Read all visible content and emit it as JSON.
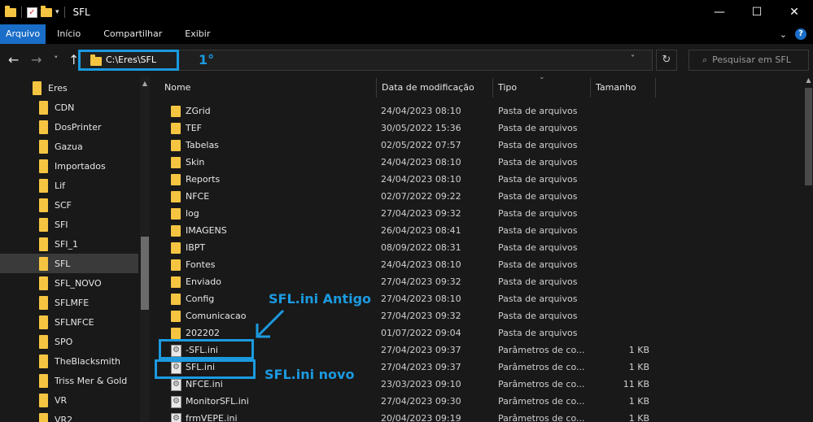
{
  "window": {
    "title": "SFL",
    "controls": {
      "minimize": "—",
      "maximize": "☐",
      "close": "✕"
    }
  },
  "ribbon": {
    "tabs": [
      {
        "label": "Arquivo",
        "active": true
      },
      {
        "label": "Início"
      },
      {
        "label": "Compartilhar"
      },
      {
        "label": "Exibir"
      }
    ],
    "expand_icon": "chevron-down-icon",
    "help": "?"
  },
  "nav": {
    "back": "←",
    "forward": "→",
    "recent": "˅",
    "up": "↑",
    "address": "C:\\Eres\\SFL",
    "address_dropdown": "˅",
    "refresh": "↻",
    "search_placeholder": "Pesquisar em SFL"
  },
  "sidebar": {
    "items": [
      {
        "label": "Eres"
      },
      {
        "label": "CDN"
      },
      {
        "label": "DosPrinter"
      },
      {
        "label": "Gazua"
      },
      {
        "label": "Importados"
      },
      {
        "label": "Lif"
      },
      {
        "label": "SCF"
      },
      {
        "label": "SFI"
      },
      {
        "label": "SFI_1"
      },
      {
        "label": "SFL",
        "selected": true
      },
      {
        "label": "SFL_NOVO"
      },
      {
        "label": "SFLMFE"
      },
      {
        "label": "SFLNFCE"
      },
      {
        "label": "SPO"
      },
      {
        "label": "TheBlacksmith"
      },
      {
        "label": "Triss Mer & Gold"
      },
      {
        "label": "VR"
      },
      {
        "label": "VR2"
      }
    ]
  },
  "columns": {
    "name": "Nome",
    "date": "Data de modificação",
    "type": "Tipo",
    "size": "Tamanho"
  },
  "files": [
    {
      "name": "ZGrid",
      "date": "24/04/2023 08:10",
      "type": "Pasta de arquivos",
      "size": "",
      "kind": "folder"
    },
    {
      "name": "TEF",
      "date": "30/05/2022 15:36",
      "type": "Pasta de arquivos",
      "size": "",
      "kind": "folder"
    },
    {
      "name": "Tabelas",
      "date": "02/05/2022 07:57",
      "type": "Pasta de arquivos",
      "size": "",
      "kind": "folder"
    },
    {
      "name": "Skin",
      "date": "24/04/2023 08:10",
      "type": "Pasta de arquivos",
      "size": "",
      "kind": "folder"
    },
    {
      "name": "Reports",
      "date": "24/04/2023 08:10",
      "type": "Pasta de arquivos",
      "size": "",
      "kind": "folder"
    },
    {
      "name": "NFCE",
      "date": "02/07/2022 09:22",
      "type": "Pasta de arquivos",
      "size": "",
      "kind": "folder"
    },
    {
      "name": "log",
      "date": "27/04/2023 09:32",
      "type": "Pasta de arquivos",
      "size": "",
      "kind": "folder"
    },
    {
      "name": "IMAGENS",
      "date": "26/04/2023 08:41",
      "type": "Pasta de arquivos",
      "size": "",
      "kind": "folder"
    },
    {
      "name": "IBPT",
      "date": "08/09/2022 08:31",
      "type": "Pasta de arquivos",
      "size": "",
      "kind": "folder"
    },
    {
      "name": "Fontes",
      "date": "24/04/2023 08:10",
      "type": "Pasta de arquivos",
      "size": "",
      "kind": "folder"
    },
    {
      "name": "Enviado",
      "date": "27/04/2023 09:32",
      "type": "Pasta de arquivos",
      "size": "",
      "kind": "folder"
    },
    {
      "name": "Config",
      "date": "27/04/2023 08:10",
      "type": "Pasta de arquivos",
      "size": "",
      "kind": "folder"
    },
    {
      "name": "Comunicacao",
      "date": "27/04/2023 09:32",
      "type": "Pasta de arquivos",
      "size": "",
      "kind": "folder"
    },
    {
      "name": "202202",
      "date": "01/07/2022 09:04",
      "type": "Pasta de arquivos",
      "size": "",
      "kind": "folder"
    },
    {
      "name": "-SFL.ini",
      "date": "27/04/2023 09:37",
      "type": "Parâmetros de co...",
      "size": "1 KB",
      "kind": "ini"
    },
    {
      "name": "SFL.ini",
      "date": "27/04/2023 09:37",
      "type": "Parâmetros de co...",
      "size": "1 KB",
      "kind": "ini"
    },
    {
      "name": "NFCE.ini",
      "date": "23/03/2023 09:10",
      "type": "Parâmetros de co...",
      "size": "11 KB",
      "kind": "ini"
    },
    {
      "name": "MonitorSFL.ini",
      "date": "27/04/2023 09:30",
      "type": "Parâmetros de co...",
      "size": "1 KB",
      "kind": "ini"
    },
    {
      "name": "frmVEPE.ini",
      "date": "20/04/2023 09:19",
      "type": "Parâmetros de co...",
      "size": "1 KB",
      "kind": "ini"
    }
  ],
  "annotations": {
    "address_step": "1°",
    "old_label": "SFL.ini Antigo",
    "new_label": "SFL.ini novo",
    "color": "#1b9ae0"
  }
}
